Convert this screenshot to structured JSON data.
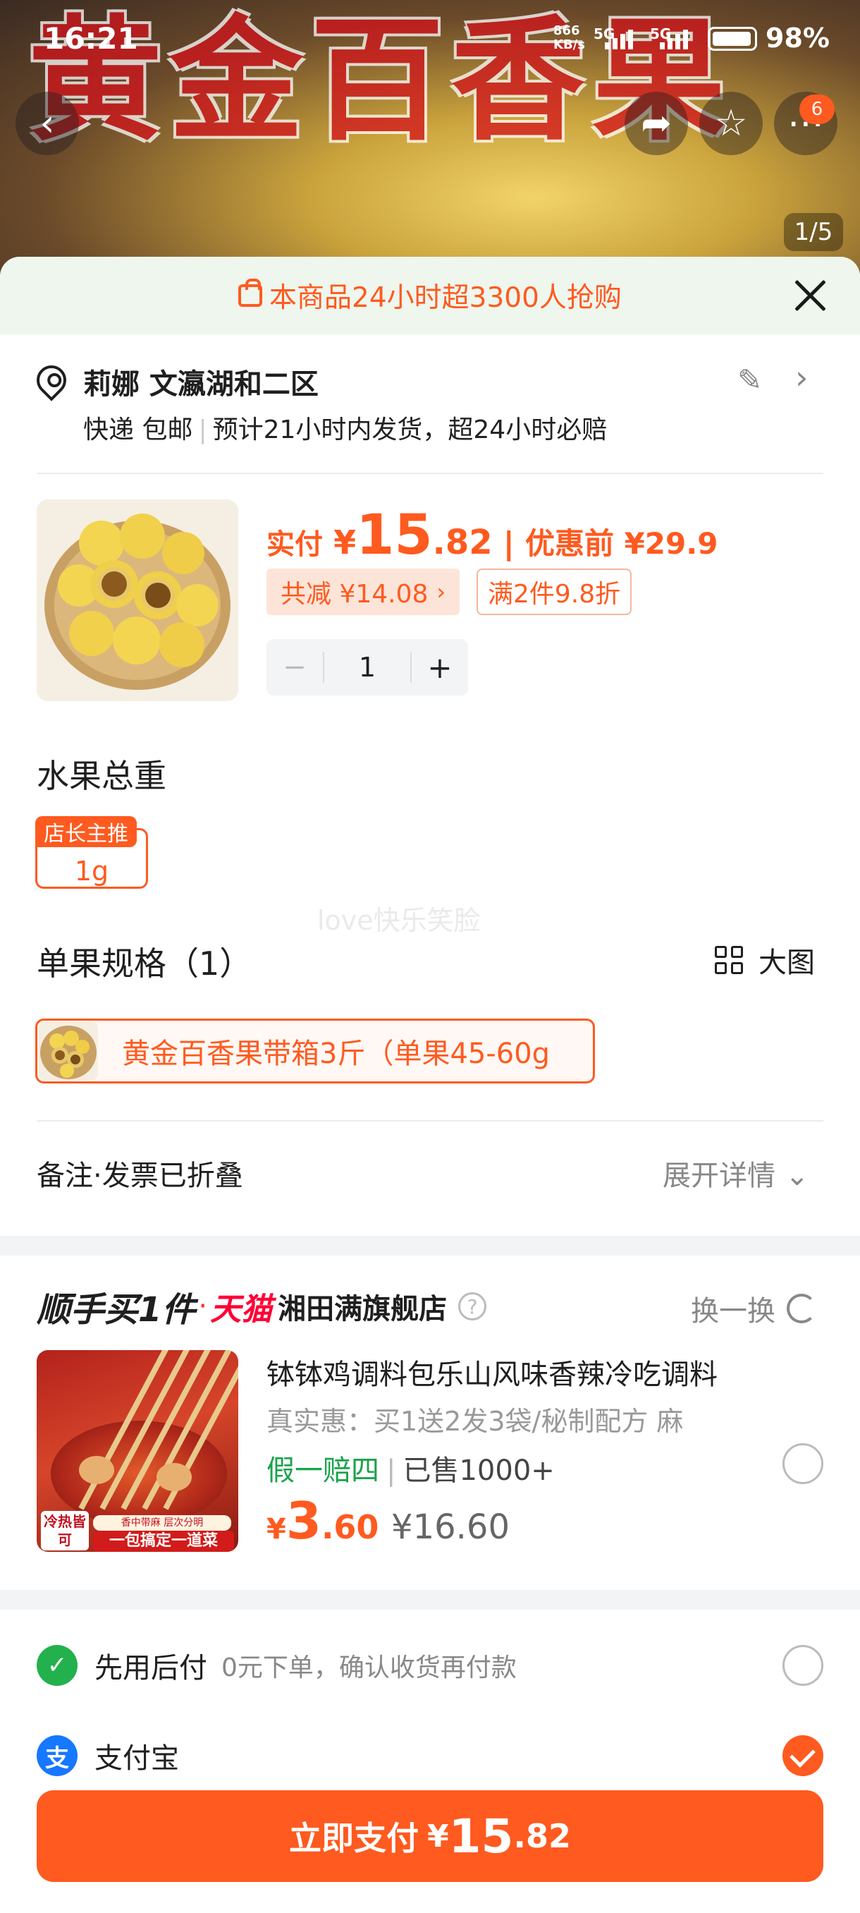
{
  "status_bar": {
    "time": "16:21",
    "network_speed_value": "866",
    "network_speed_unit": "KB/s",
    "sim1": "5G",
    "sim2": "5G",
    "battery": "98%"
  },
  "hero": {
    "title_text": "黄金百香果",
    "cart_count": "6",
    "page_indicator": "1/5"
  },
  "promo_banner": {
    "text": "本商品24小时超3300人抢购"
  },
  "address": {
    "name": "莉娜 文瀛湖和二区",
    "shipping": "快递 包邮",
    "delivery": "预计21小时内发货，超24小时必赔"
  },
  "product": {
    "price_label": "实付",
    "currency": "¥",
    "price_int": "15",
    "price_dec": ".82",
    "separator": "|",
    "original_price": "优惠前 ¥29.9",
    "discount_tag": "共减 ¥14.08",
    "promo_tag": "满2件9.8折",
    "quantity": "1",
    "minus": "−",
    "plus": "+"
  },
  "weight": {
    "title": "水果总重",
    "badge": "店长主推",
    "option": "1g"
  },
  "watermark": "love快乐笑脸",
  "spec": {
    "title": "单果规格（1）",
    "big_view": "大图",
    "option": "黄金百香果带箱3斤（单果45-60g"
  },
  "remark": {
    "label": "备注·发票已折叠",
    "expand": "展开详情"
  },
  "recommend": {
    "brand": "顺手买1件",
    "dot": "·",
    "platform": "天猫",
    "shop": "湘田满旗舰店",
    "help": "?",
    "swap": "换一换",
    "item": {
      "title": "钵钵鸡调料包乐山风味香辣冷吃调料",
      "subtitle": "真实惠：买1送2发3袋/秘制配方 麻",
      "guarantee": "假一赔四",
      "sold": "已售1000+",
      "currency": "¥",
      "price_int": "3",
      "price_dec": ".60",
      "original_price": "¥16.60",
      "thumb_label_a": "冷热皆可",
      "thumb_label_b": "香中带麻 层次分明",
      "thumb_label_c": "一包搞定一道菜",
      "selected": false
    }
  },
  "payment": {
    "options": [
      {
        "icon": "pay-later-icon",
        "label": "先用后付",
        "desc": "0元下单，确认收货再付款",
        "selected": false,
        "color": "#22b14c"
      },
      {
        "icon": "alipay-icon",
        "label": "支付宝",
        "desc": "",
        "selected": true,
        "color": "#1677ff"
      }
    ]
  },
  "pay_button": {
    "label": "立即支付",
    "currency": "¥",
    "price_int": "15",
    "price_dec": ".82"
  },
  "colors": {
    "accent": "#ff5a1f",
    "banner_bg": "#eef6ee",
    "guarantee_green": "#1aa34a",
    "tmall_red": "#ff0036"
  }
}
